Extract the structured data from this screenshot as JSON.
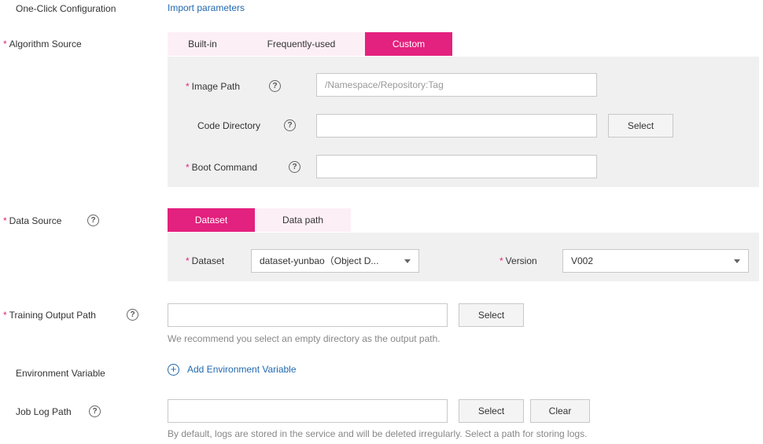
{
  "one_click": {
    "label": "One-Click Configuration",
    "link": "Import parameters"
  },
  "algorithm_source": {
    "label": "Algorithm Source",
    "tabs": [
      "Built-in",
      "Frequently-used",
      "Custom"
    ],
    "active_tab": "Custom",
    "image_path": {
      "label": "Image Path",
      "placeholder": "/Namespace/Repository:Tag",
      "value": ""
    },
    "code_directory": {
      "label": "Code Directory",
      "value": "",
      "button": "Select"
    },
    "boot_command": {
      "label": "Boot Command",
      "value": ""
    }
  },
  "data_source": {
    "label": "Data Source",
    "tabs": [
      "Dataset",
      "Data path"
    ],
    "active_tab": "Dataset",
    "dataset": {
      "label": "Dataset",
      "value": "dataset-yunbao（Object D..."
    },
    "version": {
      "label": "Version",
      "value": "V002"
    }
  },
  "training_output": {
    "label": "Training Output Path",
    "value": "",
    "button": "Select",
    "hint": "We recommend you select an empty directory as the output path."
  },
  "env_var": {
    "label": "Environment Variable",
    "add_label": "Add Environment Variable"
  },
  "job_log": {
    "label": "Job Log Path",
    "value": "",
    "select_button": "Select",
    "clear_button": "Clear",
    "hint": "By default, logs are stored in the service and will be deleted irregularly. Select a path for storing logs."
  },
  "colors": {
    "accent": "#e3217e",
    "link": "#2269b0",
    "panel": "#f0f0f0"
  }
}
